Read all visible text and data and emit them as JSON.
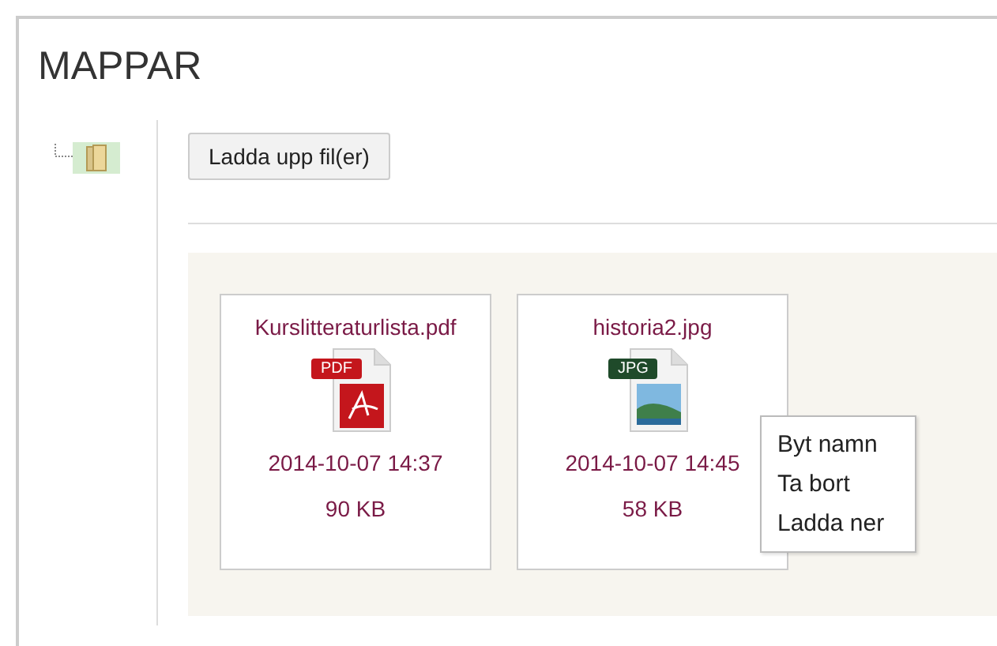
{
  "title": "MAPPAR",
  "upload_button": "Ladda upp fil(er)",
  "files": [
    {
      "name": "Kurslitteraturlista.pdf",
      "kind": "pdf",
      "badge": "PDF",
      "date": "2014-10-07 14:37",
      "size": "90 KB"
    },
    {
      "name": "historia2.jpg",
      "kind": "jpg",
      "badge": "JPG",
      "date": "2014-10-07 14:45",
      "size": "58 KB"
    }
  ],
  "context_menu": [
    "Byt namn",
    "Ta bort",
    "Ladda ner"
  ]
}
